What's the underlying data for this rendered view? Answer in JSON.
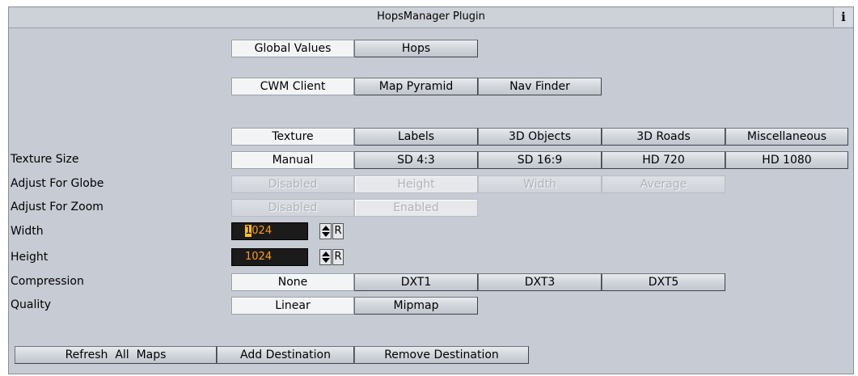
{
  "window": {
    "title": "HopsManager Plugin",
    "info_label": "i"
  },
  "top_tabs": [
    "Global Values",
    "Hops"
  ],
  "source_tabs": [
    "CWM Client",
    "Map Pyramid",
    "Nav Finder"
  ],
  "category_tabs": [
    "Texture",
    "Labels",
    "3D Objects",
    "3D Roads",
    "Miscellaneous"
  ],
  "texture_size": {
    "label": "Texture Size",
    "options": [
      "Manual",
      "SD 4:3",
      "SD 16:9",
      "HD 720",
      "HD 1080"
    ],
    "selected": "Manual"
  },
  "adjust_globe": {
    "label": "Adjust For Globe",
    "options": [
      "Disabled",
      "Height",
      "Width",
      "Average"
    ],
    "selected": "Height"
  },
  "adjust_zoom": {
    "label": "Adjust For Zoom",
    "options": [
      "Disabled",
      "Enabled"
    ],
    "selected": "Enabled"
  },
  "width": {
    "label": "Width",
    "value_selected": "1",
    "value_rest": "024",
    "reset_label": "R"
  },
  "height": {
    "label": "Height",
    "value": "1024",
    "reset_label": "R"
  },
  "compression": {
    "label": "Compression",
    "options": [
      "None",
      "DXT1",
      "DXT3",
      "DXT5"
    ],
    "selected": "None"
  },
  "quality": {
    "label": "Quality",
    "options": [
      "Linear",
      "Mipmap"
    ],
    "selected": "Linear"
  },
  "bottom_buttons": [
    "Refresh  All  Maps",
    "Add Destination",
    "Remove Destination"
  ]
}
